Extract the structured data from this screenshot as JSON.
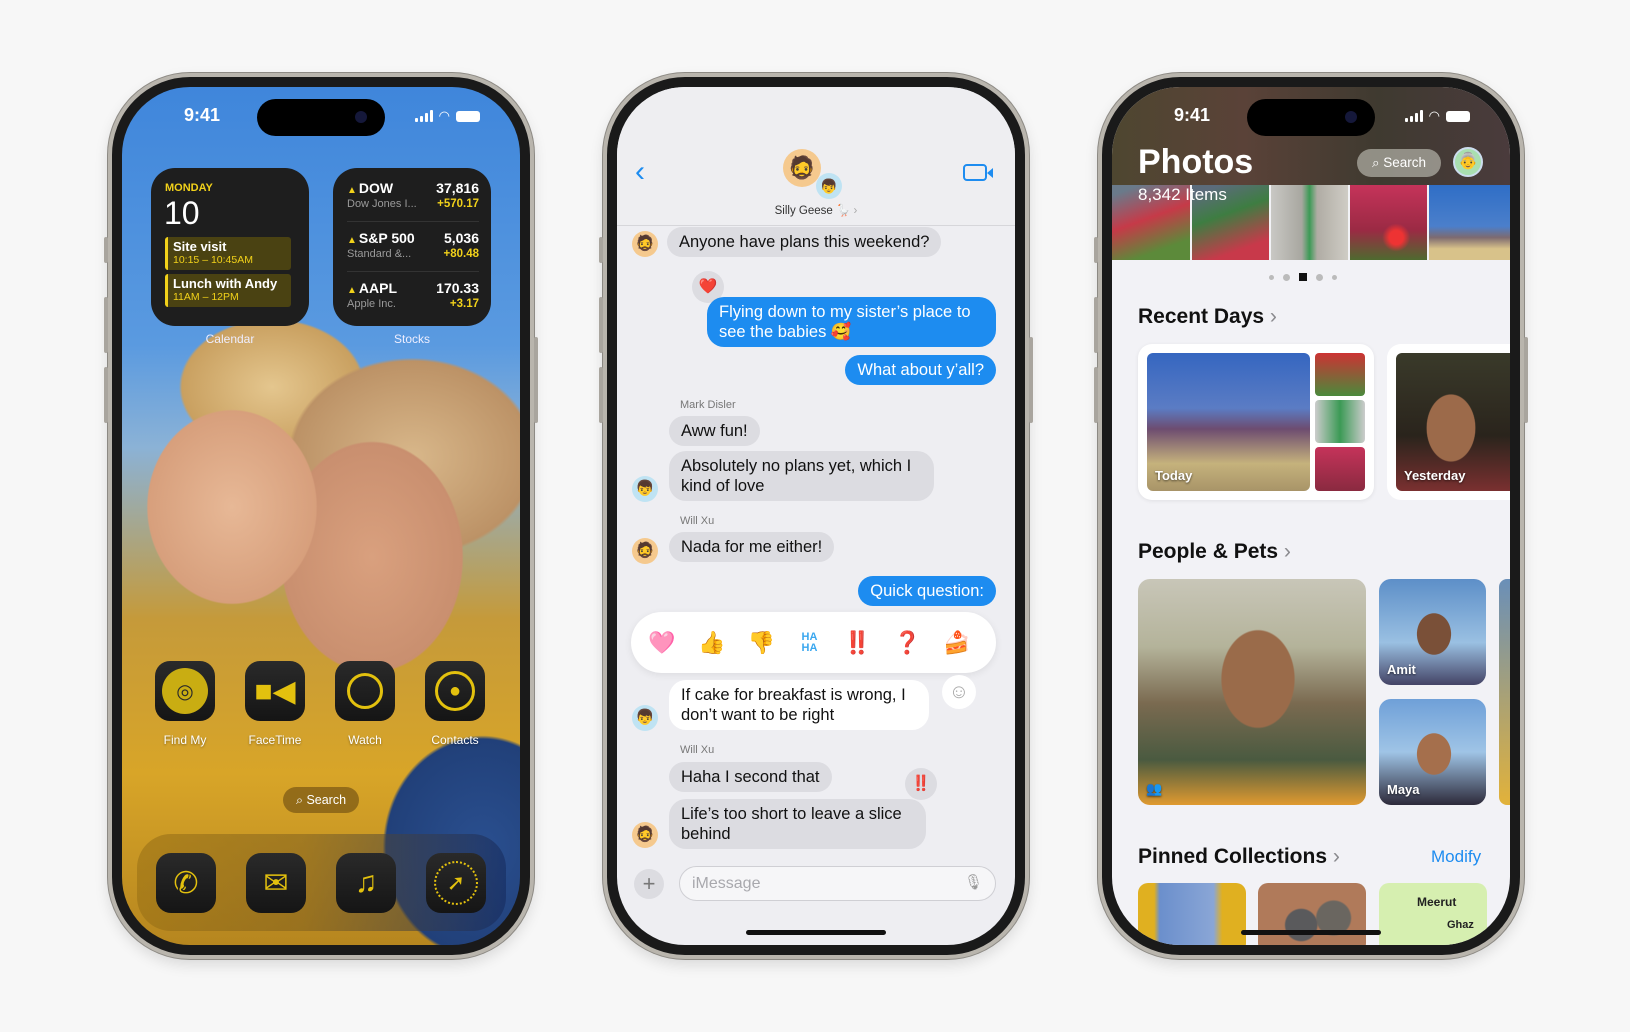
{
  "status_time": "9:41",
  "home": {
    "calendar": {
      "day": "MONDAY",
      "date": "10",
      "events": [
        {
          "title": "Site visit",
          "time": "10:15 – 10:45AM"
        },
        {
          "title": "Lunch with Andy",
          "time": "11AM – 12PM"
        }
      ],
      "label": "Calendar"
    },
    "stocks": {
      "label": "Stocks",
      "items": [
        {
          "symbol": "DOW",
          "name": "Dow Jones I...",
          "price": "37,816",
          "change": "+570.17"
        },
        {
          "symbol": "S&P 500",
          "name": "Standard &...",
          "price": "5,036",
          "change": "+80.48"
        },
        {
          "symbol": "AAPL",
          "name": "Apple Inc.",
          "price": "170.33",
          "change": "+3.17"
        }
      ]
    },
    "apps": [
      {
        "label": "Find My",
        "icon": "find-my-icon"
      },
      {
        "label": "FaceTime",
        "icon": "facetime-icon"
      },
      {
        "label": "Watch",
        "icon": "watch-icon"
      },
      {
        "label": "Contacts",
        "icon": "contacts-icon"
      }
    ],
    "search_label": "Search",
    "dock": [
      {
        "icon": "phone-icon"
      },
      {
        "icon": "mail-icon"
      },
      {
        "icon": "music-icon"
      },
      {
        "icon": "safari-icon"
      }
    ],
    "accent": "#f1d11a"
  },
  "messages": {
    "group_name": "Silly Geese 🪿",
    "thread": [
      {
        "from": "other",
        "text": "Anyone have plans this weekend?"
      },
      {
        "from": "me",
        "text": "Flying down to my sister’s place to see the babies 🥰",
        "tapback": "❤️"
      },
      {
        "from": "me",
        "text": "What about y’all?"
      },
      {
        "sender": "Mark Disler",
        "from": "other",
        "text": "Aww fun!"
      },
      {
        "from": "other",
        "text": "Absolutely no plans yet, which I kind of love"
      },
      {
        "sender": "Will Xu",
        "from": "other",
        "text": "Nada for me either!"
      },
      {
        "from": "me",
        "text": "Quick question:"
      },
      {
        "from": "other",
        "text": "If cake for breakfast is wrong, I don’t want to be right"
      },
      {
        "sender": "Will Xu",
        "from": "other",
        "text": "Haha I second that",
        "tapback": "‼️"
      },
      {
        "from": "other",
        "text": "Life’s too short to leave a slice behind"
      }
    ],
    "reactions": [
      "🩷",
      "👍",
      "👎",
      "HA HA",
      "‼️",
      "❓",
      "🍰"
    ],
    "input_placeholder": "iMessage",
    "accent": "#1d8cf0"
  },
  "photos": {
    "title": "Photos",
    "count": "8,342 Items",
    "search_label": "Search",
    "recent_days": {
      "title": "Recent Days",
      "cards": [
        "Today",
        "Yesterday"
      ]
    },
    "people_pets": {
      "title": "People & Pets",
      "people": [
        "Amit",
        "Maya"
      ]
    },
    "pinned": {
      "title": "Pinned Collections",
      "modify": "Modify",
      "map_labels": [
        "Meerut",
        "Ghaz"
      ]
    }
  }
}
